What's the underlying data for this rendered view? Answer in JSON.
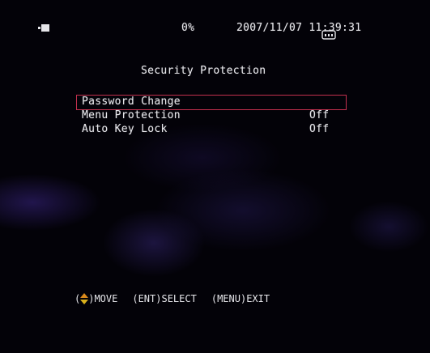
{
  "status_bar": {
    "battery_icon": "battery-icon",
    "progress": "0%",
    "datetime": "2007/11/07 11:39:31",
    "recording_icon": "camera-icon"
  },
  "screen_title": "Security Protection",
  "menu": {
    "items": [
      {
        "label": "Password Change",
        "value": "",
        "selected": true
      },
      {
        "label": "Menu Protection",
        "value": "Off",
        "selected": false
      },
      {
        "label": "Auto Key Lock",
        "value": "Off",
        "selected": false
      }
    ]
  },
  "footer": {
    "move_open": "(",
    "move_close": ")MOVE",
    "select": "(ENT)SELECT",
    "exit": "(MENU)EXIT",
    "arrow_color_up": "#d98a1c",
    "arrow_color_down": "#d9b01c"
  },
  "colors": {
    "selection_border": "#c2304e",
    "text": "#e6e6ea",
    "background": "#030208"
  }
}
